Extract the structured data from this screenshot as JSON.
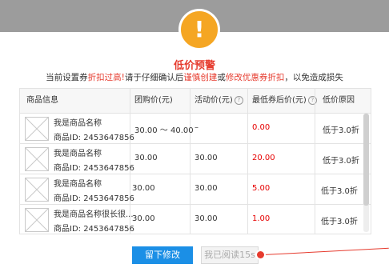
{
  "dialog": {
    "title": "低价预警",
    "subtitle_parts": [
      {
        "text": "当前设置券",
        "red": false
      },
      {
        "text": "折扣过高!",
        "red": true
      },
      {
        "text": "请于仔细确认后",
        "red": false
      },
      {
        "text": "谨慎创建",
        "red": true
      },
      {
        "text": "或",
        "red": false
      },
      {
        "text": "修改优惠券折扣",
        "red": true
      },
      {
        "text": "，以免造成损失",
        "red": false
      }
    ]
  },
  "table": {
    "headers": {
      "product": "商品信息",
      "group_price": "团购价(元)",
      "activity_price": "活动价(元)",
      "lowest_price": "最低券后价(元)",
      "reason": "低价原因"
    },
    "rows": [
      {
        "name": "我是商品名称",
        "id": "商品ID: 2453647856",
        "group_price": "30.00 ～ 40.00",
        "activity_price": "–",
        "lowest_price": "0.00",
        "reason": "低于3.0折"
      },
      {
        "name": "我是商品名称",
        "id": "商品ID: 2453647856",
        "group_price": "30.00",
        "activity_price": "30.00",
        "lowest_price": "20.00",
        "reason": "低于3.0折"
      },
      {
        "name": "我是商品名称",
        "id": "商品ID: 2453647856",
        "group_price": "30.00",
        "activity_price": "30.00",
        "lowest_price": "5.00",
        "reason": "低于3.0折"
      },
      {
        "name": "我是商品名称很长很...",
        "id": "商品ID: 2453647856",
        "group_price": "30.00",
        "activity_price": "30.00",
        "lowest_price": "1.00",
        "reason": "低于3.0折"
      }
    ]
  },
  "buttons": {
    "modify": "留下修改",
    "read": "我已阅读15s"
  },
  "colors": {
    "accent_red": "#e63b2e",
    "primary_blue": "#1b8fe6",
    "warning_orange": "#f5a623"
  }
}
